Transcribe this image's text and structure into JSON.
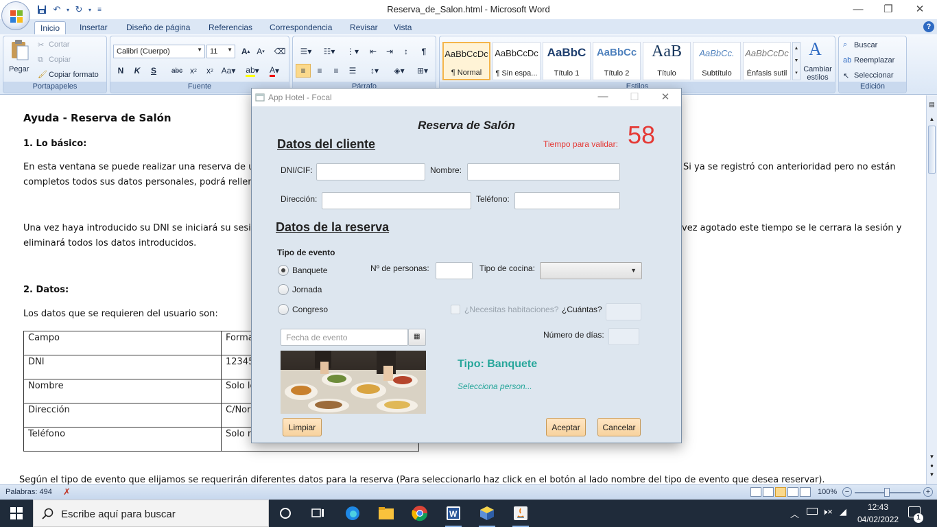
{
  "word": {
    "window_title": "Reserva_de_Salon.html - Microsoft Word",
    "tabs": [
      "Inicio",
      "Insertar",
      "Diseño de página",
      "Referencias",
      "Correspondencia",
      "Revisar",
      "Vista"
    ],
    "clipboard": {
      "paste": "Pegar",
      "cut": "Cortar",
      "copy": "Copiar",
      "format_painter": "Copiar formato",
      "group": "Portapapeles"
    },
    "font": {
      "name": "Calibri (Cuerpo)",
      "size": "11",
      "group": "Fuente"
    },
    "paragraph": {
      "group": "Párrafo"
    },
    "styles": {
      "group": "Estilos",
      "items": [
        {
          "sample": "AaBbCcDc",
          "name": "¶ Normal"
        },
        {
          "sample": "AaBbCcDc",
          "name": "¶ Sin espa..."
        },
        {
          "sample": "AaBbC",
          "name": "Título 1"
        },
        {
          "sample": "AaBbCc",
          "name": "Título 2"
        },
        {
          "sample": "AaB",
          "name": "Título"
        },
        {
          "sample": "AaBbCc.",
          "name": "Subtítulo"
        },
        {
          "sample": "AaBbCcDc",
          "name": "Énfasis sutil"
        }
      ],
      "change_styles": "Cambiar estilos"
    },
    "editing": {
      "find": "Buscar",
      "replace": "Reemplazar",
      "select": "Seleccionar",
      "group": "Edición"
    }
  },
  "document": {
    "title": "Ayuda - Reserva de Salón",
    "section1": "1.   Lo básico:",
    "p1_line1_left": "En esta ventana se puede realizar una reserva de un sa",
    "p1_line1_right": "Si ya se registró con anterioridad pero no están",
    "p1_line2_left": "completos todos sus datos personales, podrá rellenarlo",
    "p2_line1_left": "Una vez haya introducido su DNI se iniciará su sesión po",
    "p2_line1_right": "vez agotado este tiempo se le cerrara la sesión y",
    "p2_line2_left": "eliminará todos los datos introducidos.",
    "section2": "2.   Datos:",
    "p3": "Los datos que se requieren del usuario son:",
    "table": [
      [
        "Campo",
        "Forma"
      ],
      [
        "DNI",
        "12345"
      ],
      [
        "Nombre",
        "Solo le"
      ],
      [
        "Dirección",
        "C/Nor"
      ],
      [
        "Teléfono",
        "Solo n"
      ]
    ],
    "bottom_line": "Según el tipo de evento que elijamos se requerirán diferentes datos para la reserva (Para seleccionarlo haz click en el botón al lado nombre del tipo de evento que desea reservar)."
  },
  "status": {
    "words": "Palabras: 494",
    "zoom": "100%"
  },
  "taskbar": {
    "search_placeholder": "Escribe aquí para buscar",
    "time": "12:43",
    "date": "04/02/2022",
    "notifications": "1"
  },
  "dialog": {
    "title": "App Hotel - Focal",
    "heading": "Reserva de Salón",
    "client_section": "Datos del cliente",
    "timer_label": "Tiempo para validar:",
    "timer_value": "58",
    "dni_label": "DNI/CIF:",
    "name_label": "Nombre:",
    "address_label": "Dirección:",
    "phone_label": "Teléfono:",
    "reservation_section": "Datos de la reserva",
    "event_type_label": "Tipo de evento",
    "event_types": [
      "Banquete",
      "Jornada",
      "Congreso"
    ],
    "selected_event": "Banquete",
    "people_label": "Nº de personas:",
    "cuisine_label": "Tipo de cocina:",
    "rooms_label": "¿Necesitas habitaciones?",
    "how_many_label": "¿Cuántas?",
    "date_placeholder": "Fecha de evento",
    "days_label": "Número de días:",
    "type_info": "Tipo: Banquete",
    "type_hint": "Selecciona person...",
    "btn_clear": "Limpiar",
    "btn_accept": "Aceptar",
    "btn_cancel": "Cancelar"
  },
  "colors": {
    "timer": "#e53935",
    "teal_text": "#26a69a",
    "button_bg": "#f7d29e",
    "ribbon_bg": "#dbe7f6"
  }
}
